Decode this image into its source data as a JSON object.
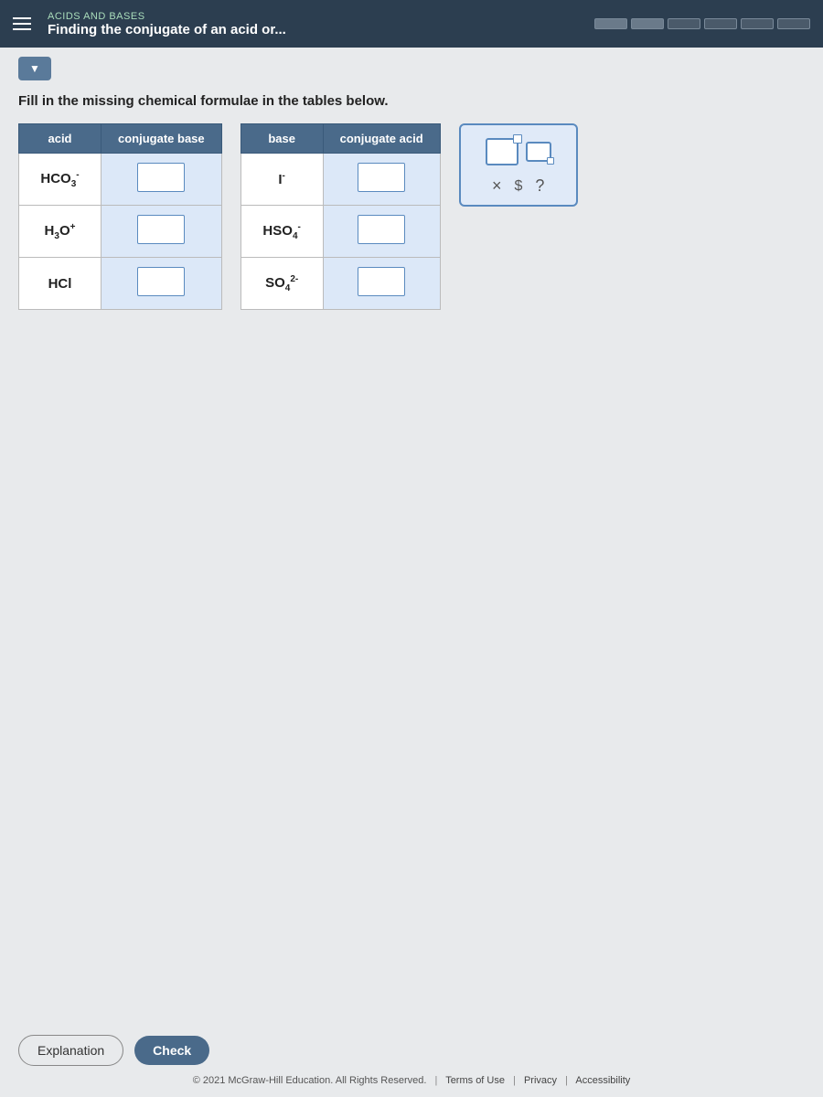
{
  "topbar": {
    "subtitle": "ACIDS AND BASES",
    "title": "Finding the conjugate of an acid or...",
    "hamburger_label": "menu"
  },
  "progress": {
    "segments": [
      {
        "filled": true
      },
      {
        "filled": true
      },
      {
        "filled": false
      },
      {
        "filled": false
      },
      {
        "filled": false
      },
      {
        "filled": false
      }
    ]
  },
  "instruction": "Fill in the missing chemical formulae in the tables below.",
  "table_left": {
    "headers": [
      "acid",
      "conjugate base"
    ],
    "rows": [
      {
        "acid": "HCO₃⁻",
        "acid_html": "HCO<sub>3</sub><sup>-</sup>"
      },
      {
        "acid": "H₃O⁺",
        "acid_html": "H<sub>3</sub>O<sup>+</sup>"
      },
      {
        "acid": "HCl",
        "acid_html": "HCl"
      }
    ]
  },
  "table_right": {
    "headers": [
      "base",
      "conjugate acid"
    ],
    "rows": [
      {
        "base": "I⁻",
        "base_html": "I<sup>-</sup>"
      },
      {
        "base": "HSO₄⁻",
        "base_html": "HSO<sub>4</sub><sup>-</sup>"
      },
      {
        "base": "SO₄²⁻",
        "base_html": "SO<sub>4</sub><sup>2-</sup>"
      }
    ]
  },
  "answer_panel": {
    "icon1_label": "superscript box",
    "icon2_label": "subscript box"
  },
  "actions": {
    "close_label": "×",
    "dollar_label": "$",
    "question_label": "?"
  },
  "buttons": {
    "explanation": "Explanation",
    "check": "Check"
  },
  "footer": {
    "copyright": "© 2021 McGraw-Hill Education. All Rights Reserved.",
    "terms": "Terms of Use",
    "privacy": "Privacy",
    "accessibility": "Accessibility"
  }
}
